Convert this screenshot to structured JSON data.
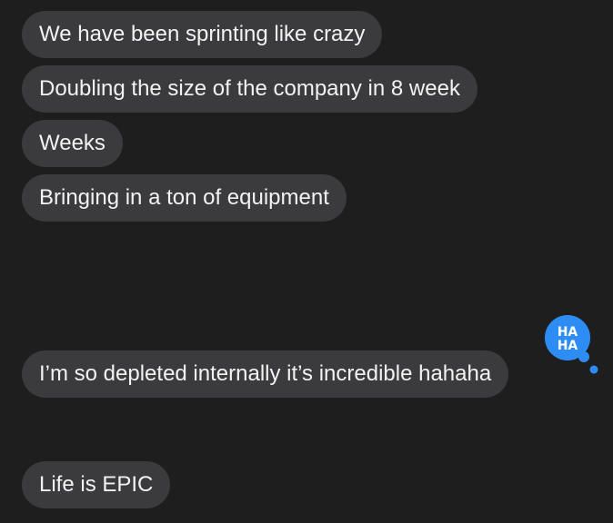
{
  "messages": [
    {
      "text": "We have been sprinting like crazy"
    },
    {
      "text": "Doubling the size of the company in 8 week"
    },
    {
      "text": "Weeks"
    },
    {
      "text": "Bringing in a ton of equipment"
    },
    {
      "text": "I’m so depleted internally it’s incredible hahaha",
      "tapback": {
        "label": "HA HA",
        "icon": "haha-tapback-icon"
      }
    },
    {
      "text": "Life is EPIC"
    }
  ],
  "colors": {
    "background": "#1e1e1e",
    "bubble": "#3b3b3d",
    "bubble_text": "#f2f2f2",
    "tapback": "#2e8df5"
  }
}
